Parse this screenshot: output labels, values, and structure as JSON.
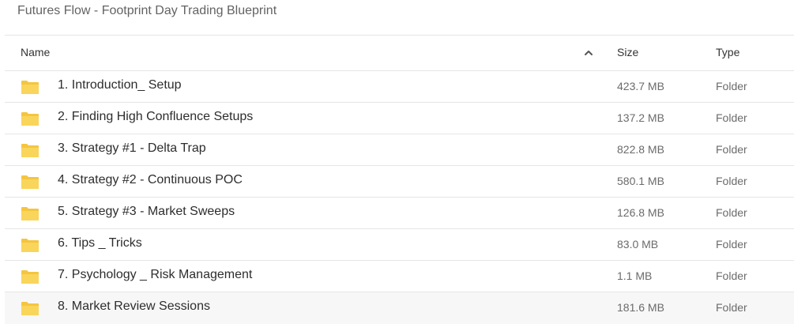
{
  "breadcrumb": "Futures Flow - Footprint Day Trading Blueprint",
  "columns": {
    "name": "Name",
    "size": "Size",
    "type": "Type"
  },
  "sort": {
    "icon": "chevron-up-icon",
    "direction": "ascending"
  },
  "folder_icon_color": "#F5C53F",
  "rows": [
    {
      "name": "1. Introduction_ Setup",
      "size": "423.7 MB",
      "type": "Folder"
    },
    {
      "name": "2. Finding High Confluence Setups",
      "size": "137.2 MB",
      "type": "Folder"
    },
    {
      "name": "3. Strategy #1 - Delta Trap",
      "size": "822.8 MB",
      "type": "Folder"
    },
    {
      "name": "4. Strategy #2 - Continuous POC",
      "size": "580.1 MB",
      "type": "Folder"
    },
    {
      "name": "5. Strategy #3 - Market Sweeps",
      "size": "126.8 MB",
      "type": "Folder"
    },
    {
      "name": "6. Tips _ Tricks",
      "size": "83.0 MB",
      "type": "Folder"
    },
    {
      "name": "7. Psychology _ Risk Management",
      "size": "1.1 MB",
      "type": "Folder"
    },
    {
      "name": "8. Market Review Sessions",
      "size": "181.6 MB",
      "type": "Folder"
    }
  ]
}
